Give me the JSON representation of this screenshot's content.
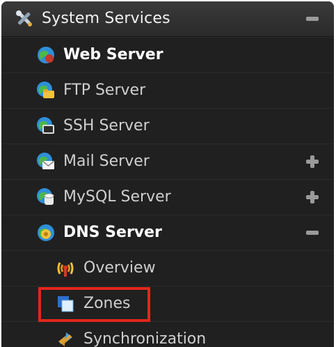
{
  "header": {
    "title": "System Services",
    "icon": "tools-icon",
    "toggle": "minus-icon"
  },
  "items": [
    {
      "label": "Web Server",
      "icon": "web-server-globe-icon",
      "toggle": null,
      "active": true
    },
    {
      "label": "FTP Server",
      "icon": "ftp-folder-globe-icon",
      "toggle": null
    },
    {
      "label": "SSH Server",
      "icon": "ssh-terminal-globe-icon",
      "toggle": null
    },
    {
      "label": "Mail Server",
      "icon": "mail-envelope-globe-icon",
      "toggle": "plus-icon"
    },
    {
      "label": "MySQL Server",
      "icon": "database-globe-icon",
      "toggle": "plus-icon"
    },
    {
      "label": "DNS Server",
      "icon": "dns-globe-icon",
      "toggle": "minus-icon"
    }
  ],
  "dns_children": [
    {
      "label": "Overview",
      "icon": "broadcast-antenna-icon"
    },
    {
      "label": "Zones",
      "icon": "zones-windows-icon",
      "highlighted": true
    },
    {
      "label": "Synchronization",
      "icon": "sync-arrows-icon"
    }
  ],
  "colors": {
    "panel": "#202020",
    "highlight_border": "#e3261c",
    "text": "#cfcfcf"
  }
}
